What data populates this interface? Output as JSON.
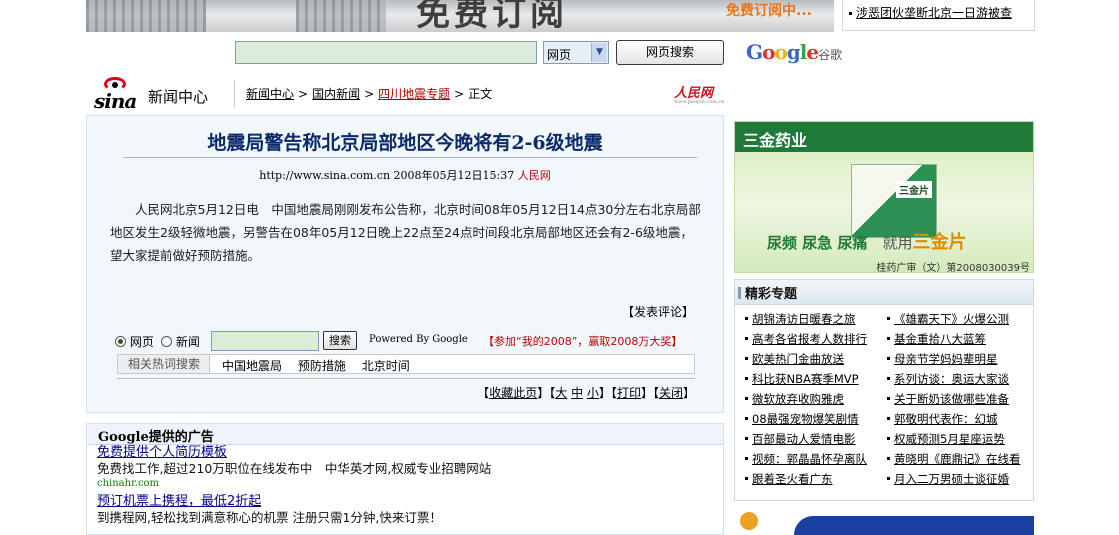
{
  "banner": {
    "headline": "免费订阅",
    "sub": "免费订阅中...",
    "side_item": "涉恶团伙垄断北京一日游被查"
  },
  "search": {
    "input_value": "",
    "scope_selected": "网页",
    "button_label": "网页搜索",
    "google_word": "Google",
    "google_cn": "谷歌"
  },
  "nav": {
    "logo_text": "sina",
    "section_title": "新闻中心",
    "breadcrumb": [
      "新闻中心",
      "国内新闻",
      "四川地震专题"
    ],
    "current": "正文",
    "partner_logo": "人民网",
    "partner_logo_sub": "www.people.com.cn"
  },
  "article": {
    "title": "地震局警告称北京局部地区今晚将有2-6级地震",
    "url": "http://www.sina.com.cn",
    "datetime": "2008年05月12日15:37",
    "source": "人民网",
    "body": "　　人民网北京5月12日电　中国地震局刚刚发布公告称，北京时间08年05月12日14点30分左右北京局部地区发生2级轻微地震，另警告在08年05月12日晚上22点至24点时间段北京局部地区还会有2-6级地震，望大家提前做好预防措施。",
    "comment_link": "【发表评论】"
  },
  "inline_search": {
    "opt_web": "网页",
    "opt_news": "新闻",
    "button": "搜索",
    "powered": "Powered By Google",
    "promo": "【参加“我的2008”，赢取2008万大奖】"
  },
  "hot_terms": {
    "label": "相关热词搜索",
    "terms": [
      "中国地震局",
      "预防措施",
      "北京时间"
    ]
  },
  "tools": {
    "favorite": "收藏此页",
    "size_large": "大",
    "size_mid": "中",
    "size_small": "小",
    "print": "打印",
    "close": "关闭"
  },
  "ads": {
    "header": "Google提供的广告",
    "items": [
      {
        "title": "免费提供个人简历模板",
        "desc": "免费找工作,超过210万职位在线发布中　中华英才网,权威专业招聘网站",
        "url": "chinahr.com"
      },
      {
        "title": "预订机票上携程，最低2折起",
        "desc": "到携程网,轻松找到满意称心的机票 注册只需1分钟,快来订票！",
        "url": ""
      }
    ]
  },
  "side_ad": {
    "brand": "三金药业",
    "product_label": "三金片",
    "slogan_a": "尿频 尿急 尿痛",
    "slogan_b": "就用",
    "slogan_c": "三金片",
    "approval": "桂药广审（文）第2008030039号"
  },
  "topics": {
    "header": "精彩专题",
    "left": [
      "胡锦涛访日暖春之旅",
      "高考各省报考人数排行",
      "欧美热门金曲放送",
      "科比获NBA赛季MVP",
      "微软放弃收购雅虎",
      "08最强宠物爆笑剧情",
      "百部最动人爱情电影",
      "视频：郭晶晶怀孕离队",
      "跟着圣火看广东"
    ],
    "right": [
      "《雄霸天下》火爆公测",
      "基金重拾八大蓝筹",
      "母亲节学妈妈辈明星",
      "系列访谈：奥运大家谈",
      "关于断奶该做哪些准备",
      "郭敬明代表作：幻城",
      "权威预测5月星座运势",
      "黄晓明《鹿鼎记》在线看",
      "月入二万男硕士谈征婚"
    ]
  },
  "colors": {
    "title_blue": "#0a2a6b",
    "source_red": "#c00000",
    "panel_bg": "#f2f7fc",
    "input_green": "#dcecd8"
  }
}
